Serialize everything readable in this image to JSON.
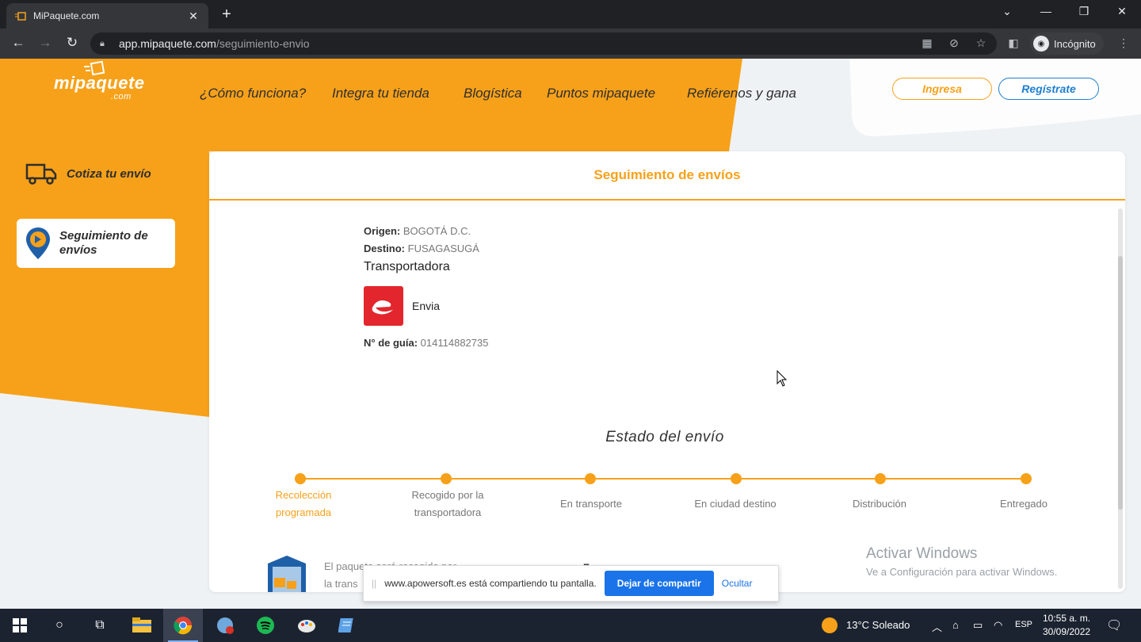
{
  "browser": {
    "tab_title": "MiPaquete.com",
    "url_host": "app.mipaquete.com",
    "url_path": "/seguimiento-envio",
    "profile_label": "Incógnito"
  },
  "header": {
    "logo_text": "mipaquete",
    "logo_suffix": ".com",
    "menu": [
      "¿Cómo funciona?",
      "Integra tu tienda",
      "Blogística",
      "Puntos mipaquete",
      "Refiérenos y gana"
    ],
    "login_label": "Ingresa",
    "register_label": "Regístrate"
  },
  "sidebar": {
    "quote_label": "Cotiza tu envío",
    "tracking_label_1": "Seguimiento de",
    "tracking_label_2": "envíos"
  },
  "card": {
    "title": "Seguimiento de envíos",
    "origin_label": "Origen:",
    "origin_value": "BOGOTÁ D.C.",
    "dest_label": "Destino:",
    "dest_value": "FUSAGASUGÁ",
    "carrier_heading": "Transportadora",
    "carrier_name": "Envia",
    "guide_label": "N° de guía:",
    "guide_value": "014114882735",
    "status_title": "Estado del envío",
    "steps": [
      {
        "l1": "Recolección",
        "l2": "programada"
      },
      {
        "l1": "Recogido por la",
        "l2": "transportadora"
      },
      {
        "l1": "En transporte",
        "l2": ""
      },
      {
        "l1": "En ciudad destino",
        "l2": ""
      },
      {
        "l1": "Distribución",
        "l2": ""
      },
      {
        "l1": "Entregado",
        "l2": ""
      }
    ],
    "package_text_1": "El paquete será recogido por",
    "package_text_2": "la trans",
    "date_partial": "Enero"
  },
  "os": {
    "activate_title": "Activar Windows",
    "activate_sub": "Ve a Configuración para activar Windows.",
    "share_text": "www.apowersoft.es está compartiendo tu pantalla.",
    "share_stop": "Dejar de compartir",
    "share_hide": "Ocultar",
    "weather": "13°C  Soleado",
    "lang": "ESP",
    "time": "10:55 a. m.",
    "date": "30/09/2022"
  },
  "colors": {
    "brand_orange": "#f7a11a",
    "brand_blue": "#1f7fcf",
    "envia_red": "#e3262d"
  }
}
